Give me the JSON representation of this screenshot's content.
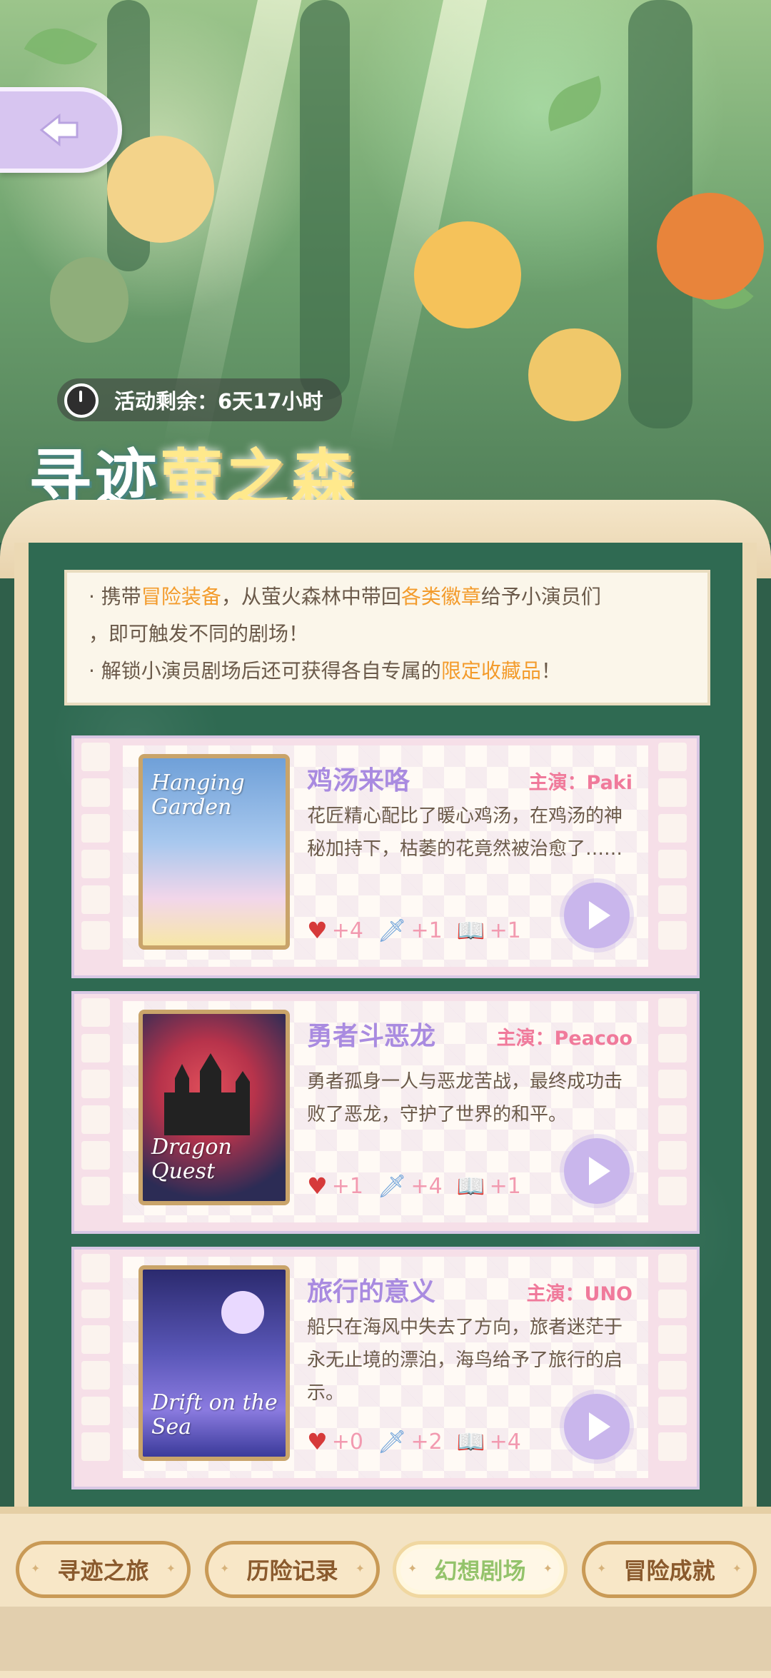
{
  "event": {
    "time_remaining": "活动剩余：6天17小时",
    "title_part1": "寻迹",
    "title_part2": "萤之森"
  },
  "description": {
    "line1_a": "· 携带",
    "line1_hl1": "冒险装备",
    "line1_b": "，从萤火森林中带回",
    "line1_hl2": "各类徽章",
    "line1_c": "给予小演员们",
    "line2": "，即可触发不同的剧场！",
    "line3_a": "· 解锁小演员剧场后还可获得各自专属的",
    "line3_hl": "限定收藏品",
    "line3_b": "！"
  },
  "stories": [
    {
      "poster_title": "Hanging Garden",
      "title": "鸡汤来咯",
      "lead": "主演：Paki",
      "desc": "花匠精心配比了暖心鸡汤，在鸡汤的神秘加持下，枯萎的花竟然被治愈了……",
      "heart": "+4",
      "sword": "+1",
      "book": "+1"
    },
    {
      "poster_title": "Dragon Quest",
      "title": "勇者斗恶龙",
      "lead": "主演：Peacoo",
      "desc": "勇者孤身一人与恶龙苦战，最终成功击败了恶龙，守护了世界的和平。",
      "heart": "+1",
      "sword": "+4",
      "book": "+1"
    },
    {
      "poster_title": "Drift on the Sea",
      "title": "旅行的意义",
      "lead": "主演：UNO",
      "desc": "船只在海风中失去了方向，旅者迷茫于永无止境的漂泊，海鸟给予了旅行的启示。",
      "heart": "+0",
      "sword": "+2",
      "book": "+4"
    }
  ],
  "tabs": [
    {
      "label": "寻迹之旅"
    },
    {
      "label": "历险记录"
    },
    {
      "label": "幻想剧场"
    },
    {
      "label": "冒险成就"
    }
  ],
  "colors": {
    "accent_purple": "#a98be0",
    "accent_pink": "#f07a9b",
    "highlight_orange": "#f39b2b",
    "panel_green": "#2f6a52"
  }
}
